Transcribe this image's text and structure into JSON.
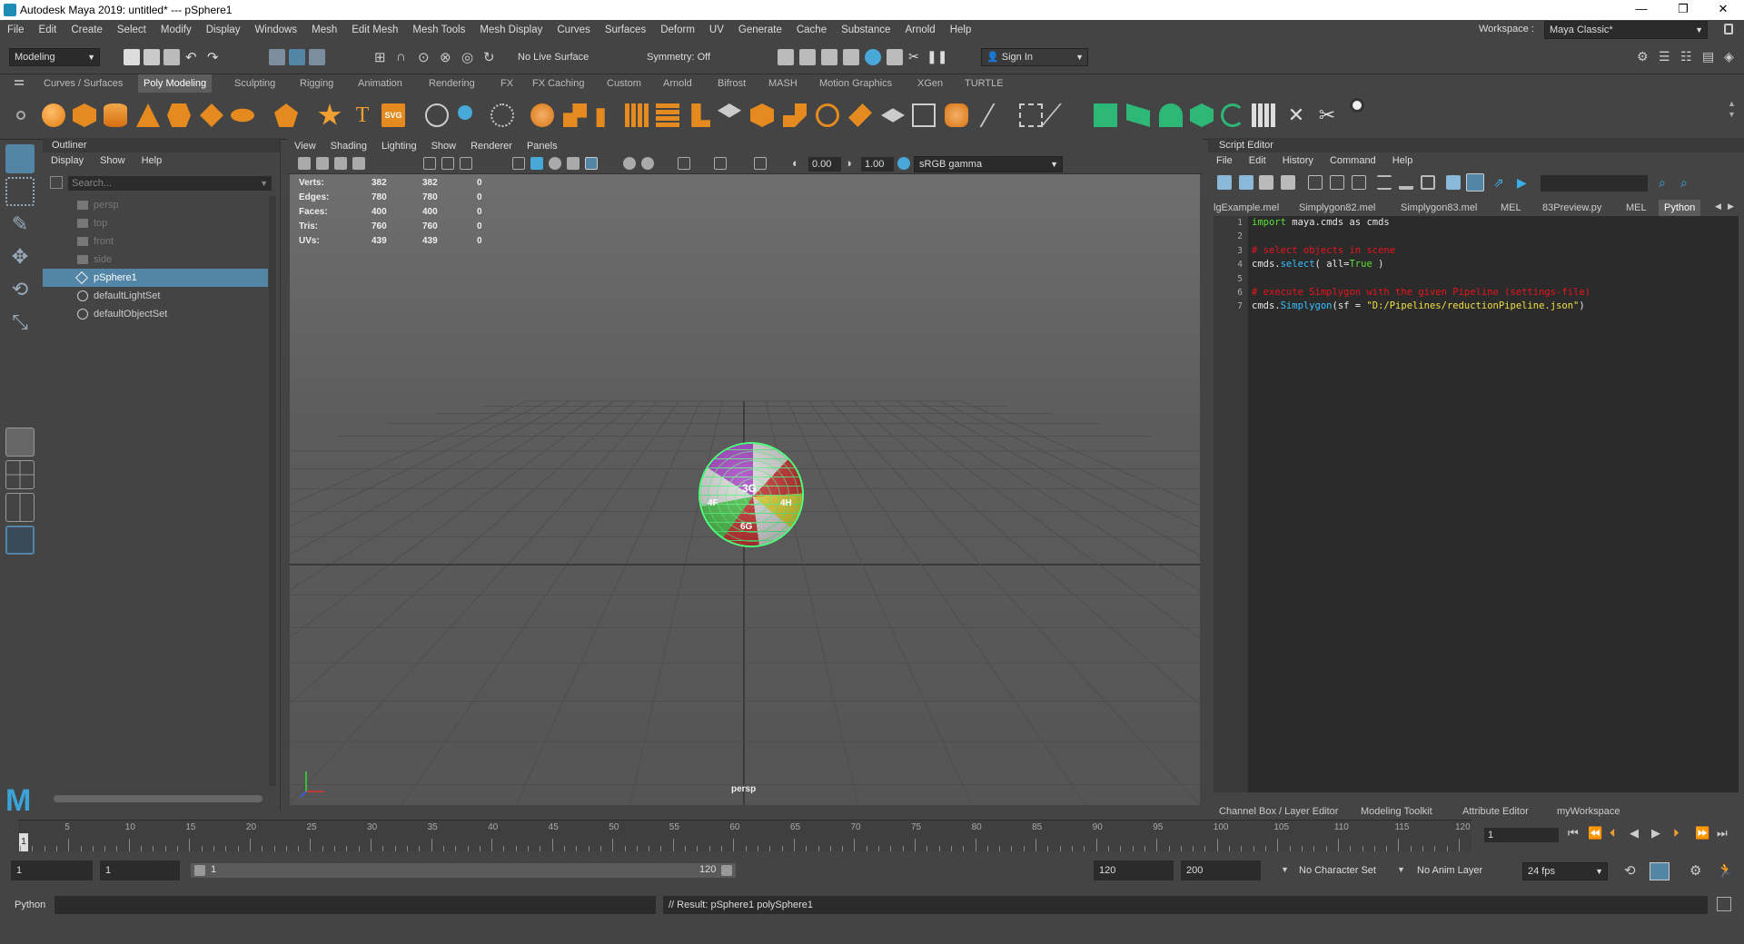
{
  "window": {
    "title": "Autodesk Maya 2019: untitled*   ---   pSphere1",
    "min": "—",
    "restore": "❐",
    "close": "✕"
  },
  "menus": [
    "File",
    "Edit",
    "Create",
    "Select",
    "Modify",
    "Display",
    "Windows",
    "Mesh",
    "Edit Mesh",
    "Mesh Tools",
    "Mesh Display",
    "Curves",
    "Surfaces",
    "Deform",
    "UV",
    "Generate",
    "Cache",
    "Substance",
    "Arnold",
    "Help"
  ],
  "workspace": {
    "label": "Workspace :",
    "value": "Maya Classic*"
  },
  "status": {
    "mode": "Modeling",
    "live_surface": "No Live Surface",
    "symmetry": "Symmetry: Off",
    "sign_in": "Sign In"
  },
  "shelf_tabs": [
    "Curves / Surfaces",
    "Poly Modeling",
    "Sculpting",
    "Rigging",
    "Animation",
    "Rendering",
    "FX",
    "FX Caching",
    "Custom",
    "Arnold",
    "Bifrost",
    "MASH",
    "Motion Graphics",
    "XGen",
    "TURTLE"
  ],
  "shelf_active": "Poly Modeling",
  "shelf_text_icons": {
    "text": "T",
    "svg": "SVG"
  },
  "outliner": {
    "title": "Outliner",
    "menu": [
      "Display",
      "Show",
      "Help"
    ],
    "search_placeholder": "Search...",
    "items": [
      {
        "label": "persp",
        "dim": true
      },
      {
        "label": "top",
        "dim": true
      },
      {
        "label": "front",
        "dim": true
      },
      {
        "label": "side",
        "dim": true
      },
      {
        "label": "pSphere1",
        "selected": true
      },
      {
        "label": "defaultLightSet"
      },
      {
        "label": "defaultObjectSet"
      }
    ]
  },
  "viewport": {
    "menu": [
      "View",
      "Shading",
      "Lighting",
      "Show",
      "Renderer",
      "Panels"
    ],
    "field1": "0.00",
    "field2": "1.00",
    "color_space": "sRGB gamma",
    "camera": "persp",
    "hud": [
      {
        "label": "Verts:",
        "a": "382",
        "b": "382",
        "c": "0"
      },
      {
        "label": "Edges:",
        "a": "780",
        "b": "780",
        "c": "0"
      },
      {
        "label": "Faces:",
        "a": "400",
        "b": "400",
        "c": "0"
      },
      {
        "label": "Tris:",
        "a": "760",
        "b": "760",
        "c": "0"
      },
      {
        "label": "UVs:",
        "a": "439",
        "b": "439",
        "c": "0"
      }
    ],
    "sphere_labels": [
      "3G",
      "4F",
      "4H",
      "6G"
    ]
  },
  "script_editor": {
    "title": "Script Editor",
    "menu": [
      "File",
      "Edit",
      "History",
      "Command",
      "Help"
    ],
    "tabs": [
      "lgExample.mel",
      "Simplygon82.mel",
      "Simplygon83.mel",
      "MEL",
      "83Preview.py",
      "MEL",
      "Python"
    ],
    "active_tab": "Python",
    "line_numbers": [
      "1",
      "2",
      "3",
      "4",
      "5",
      "6",
      "7"
    ],
    "code": {
      "l1_kw": "import",
      "l1_rest": " maya.cmds as cmds",
      "l3": "# select objects in scene",
      "l4_a": "cmds.",
      "l4_fn": "select",
      "l4_b": "( all=",
      "l4_kw": "True",
      "l4_c": " )",
      "l6": "# execute Simplygon with the given Pipeline (settings-file)",
      "l7_a": "cmds.",
      "l7_fn": "Simplygon",
      "l7_b": "(sf = ",
      "l7_str": "\"D:/Pipelines/reductionPipeline.json\"",
      "l7_c": ")"
    }
  },
  "bottom_tabs": [
    "Channel Box / Layer Editor",
    "Modeling Toolkit",
    "Attribute Editor",
    "myWorkspace"
  ],
  "timeline": {
    "ticks": [
      "1",
      "5",
      "10",
      "15",
      "20",
      "25",
      "30",
      "35",
      "40",
      "45",
      "50",
      "55",
      "60",
      "65",
      "70",
      "75",
      "80",
      "85",
      "90",
      "95",
      "100",
      "105",
      "110",
      "115",
      "120"
    ],
    "current_frame": "1"
  },
  "range": {
    "start": "1",
    "start2": "1",
    "slider_start": "1",
    "slider_end": "120",
    "end": "120",
    "end2": "200",
    "character_set": "No Character Set",
    "anim_layer": "No Anim Layer",
    "fps": "24 fps"
  },
  "command_line": {
    "lang": "Python",
    "result": "// Result: pSphere1 polySphere1"
  },
  "colors": {
    "accent": "#5285a6",
    "sphere_wire": "#4dff7a"
  }
}
